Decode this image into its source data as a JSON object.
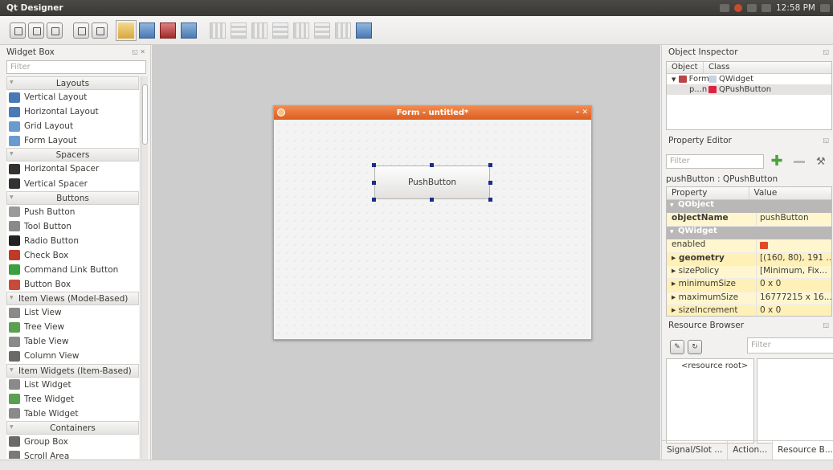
{
  "topbar": {
    "app_title": "Qt Designer",
    "clock": "12:58 PM"
  },
  "widget_box": {
    "title": "Widget Box",
    "filter_placeholder": "Filter",
    "sections": [
      {
        "label": "Layouts",
        "align": "center",
        "items": [
          {
            "label": "Vertical Layout",
            "icon": "vertical-layout-icon",
            "color": "#4a79b5"
          },
          {
            "label": "Horizontal Layout",
            "icon": "horizontal-layout-icon",
            "color": "#4a79b5"
          },
          {
            "label": "Grid Layout",
            "icon": "grid-layout-icon",
            "color": "#6b9ad0"
          },
          {
            "label": "Form Layout",
            "icon": "form-layout-icon",
            "color": "#6b9ad0"
          }
        ]
      },
      {
        "label": "Spacers",
        "align": "center",
        "items": [
          {
            "label": "Horizontal Spacer",
            "icon": "horizontal-spacer-icon",
            "color": "#333333"
          },
          {
            "label": "Vertical Spacer",
            "icon": "vertical-spacer-icon",
            "color": "#333333"
          }
        ]
      },
      {
        "label": "Buttons",
        "align": "center",
        "items": [
          {
            "label": "Push Button",
            "icon": "push-button-icon",
            "color": "#9a9a9a"
          },
          {
            "label": "Tool Button",
            "icon": "tool-button-icon",
            "color": "#8a8a8a"
          },
          {
            "label": "Radio Button",
            "icon": "radio-button-icon",
            "color": "#222222"
          },
          {
            "label": "Check Box",
            "icon": "check-box-icon",
            "color": "#c03a2a"
          },
          {
            "label": "Command Link Button",
            "icon": "command-link-icon",
            "color": "#3aa040"
          },
          {
            "label": "Button Box",
            "icon": "button-box-icon",
            "color": "#c74a3a"
          }
        ]
      },
      {
        "label": "Item Views (Model-Based)",
        "align": "left",
        "items": [
          {
            "label": "List View",
            "icon": "list-view-icon",
            "color": "#8a8a8a"
          },
          {
            "label": "Tree View",
            "icon": "tree-view-icon",
            "color": "#5aa050"
          },
          {
            "label": "Table View",
            "icon": "table-view-icon",
            "color": "#8a8a8a"
          },
          {
            "label": "Column View",
            "icon": "column-view-icon",
            "color": "#6a6a6a"
          }
        ]
      },
      {
        "label": "Item Widgets (Item-Based)",
        "align": "left",
        "items": [
          {
            "label": "List Widget",
            "icon": "list-widget-icon",
            "color": "#8a8a8a"
          },
          {
            "label": "Tree Widget",
            "icon": "tree-widget-icon",
            "color": "#5aa050"
          },
          {
            "label": "Table Widget",
            "icon": "table-widget-icon",
            "color": "#8a8a8a"
          }
        ]
      },
      {
        "label": "Containers",
        "align": "center",
        "items": [
          {
            "label": "Group Box",
            "icon": "group-box-icon",
            "color": "#6a6a6a"
          },
          {
            "label": "Scroll Area",
            "icon": "scroll-area-icon",
            "color": "#7a7a7a"
          }
        ]
      }
    ]
  },
  "form": {
    "title": "Form - untitled*",
    "button_label": "PushButton"
  },
  "object_inspector": {
    "title": "Object Inspector",
    "col_object": "Object",
    "col_class": "Class",
    "rows": [
      {
        "object": "Form",
        "class": "QWidget"
      },
      {
        "object": "p...n",
        "class": "QPushButton"
      }
    ]
  },
  "property_editor": {
    "title": "Property Editor",
    "filter_placeholder": "Filter",
    "object_class": "pushButton : QPushButton",
    "col_property": "Property",
    "col_value": "Value",
    "group_qobject": "QObject",
    "group_qwidget": "QWidget",
    "rows": [
      {
        "property": "objectName",
        "value": "pushButton"
      },
      {
        "property": "enabled",
        "value": ""
      },
      {
        "property": "geometry",
        "value": "[(160, 80), 191 ..."
      },
      {
        "property": "sizePolicy",
        "value": "[Minimum, Fix..."
      },
      {
        "property": "minimumSize",
        "value": "0 x 0"
      },
      {
        "property": "maximumSize",
        "value": "16777215 x 16..."
      },
      {
        "property": "sizeIncrement",
        "value": "0 x 0"
      }
    ]
  },
  "resource_browser": {
    "title": "Resource Browser",
    "filter_placeholder": "Filter",
    "root_label": "<resource root>"
  },
  "tabs": [
    "Signal/Slot ...",
    "Action...",
    "Resource B..."
  ],
  "colors": {
    "form_titlebar": "#e8682a",
    "selection_handle": "#1d2d8c",
    "canvas": "#cdcdcd"
  }
}
